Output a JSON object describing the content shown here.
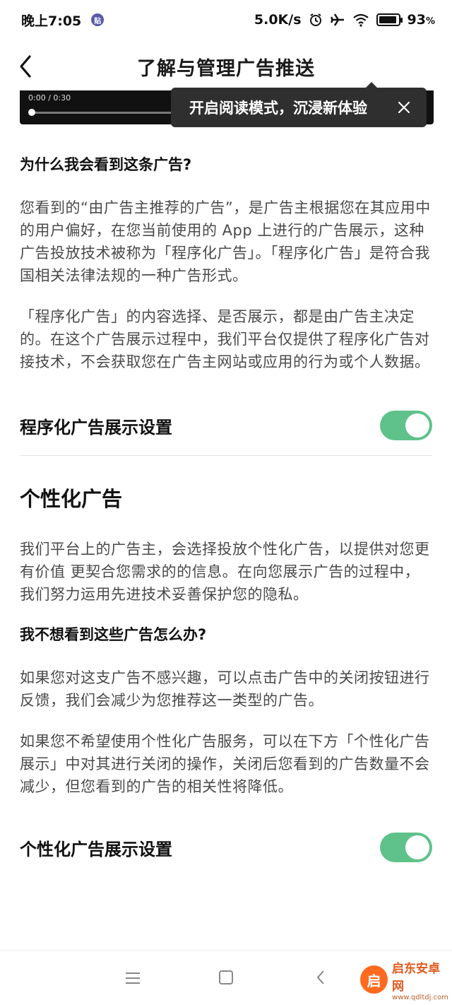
{
  "status_bar": {
    "time": "晚上7:05",
    "badge": "贴",
    "network_speed": "5.0K/s",
    "battery_level": "93",
    "icons": [
      "alarm-icon",
      "airplane-icon",
      "wifi-icon",
      "battery-icon"
    ]
  },
  "header": {
    "title": "了解与管理广告推送",
    "back_icon": "chevron-left-icon"
  },
  "video": {
    "time_label": "0:00 / 0:30"
  },
  "tooltip": {
    "text": "开启阅读模式，沉浸新体验",
    "close_icon": "close-icon"
  },
  "sections": {
    "why_heading": "为什么我会看到这条广告?",
    "why_para1": "您看到的“由广告主推荐的广告”，是广告主根据您在其应用中的用户偏好，在您当前使用的 App 上进行的广告展示，这种广告投放技术被称为「程序化广告」。「程序化广告」是符合我国相关法律法规的一种广告形式。",
    "why_para2": "「程序化广告」的内容选择、是否展示，都是由广告主决定的。在这个广告展示过程中，我们平台仅提供了程序化广告对接技术，不会获取您在广告主网站或应用的行为或个人数据。",
    "programmatic_setting_label": "程序化广告展示设置",
    "programmatic_setting_on": true,
    "personalized_heading": "个性化广告",
    "personalized_para": "我们平台上的广告主，会选择投放个性化广告，以提供对您更有价值 更契合您需求的的信息。在向您展示广告的过程中，我们努力运用先进技术妥善保护您的隐私。",
    "dont_want_heading": "我不想看到这些广告怎么办?",
    "dont_want_para1": "如果您对这支广告不感兴趣，可以点击广告中的关闭按钮进行反馈，我们会减少为您推荐这一类型的广告。",
    "dont_want_para2": "如果您不希望使用个性化广告服务，可以在下方「个性化广告展示」中对其进行关闭的操作，关闭后您看到的广告数量不会减少，但您看到的广告的相关性将降低。",
    "personalized_setting_label": "个性化广告展示设置",
    "personalized_setting_on": true
  },
  "nav": {
    "icons": [
      "menu-icon",
      "home-icon",
      "back-icon"
    ]
  },
  "watermark": {
    "name": "启东安卓网",
    "url": "www.qdltdj.com",
    "logo_char": "启"
  },
  "colors": {
    "toggle_on": "#5fc28b",
    "tooltip_bg": "#2f2f2f",
    "text_primary": "#111111",
    "text_body": "#4a4a4a"
  }
}
